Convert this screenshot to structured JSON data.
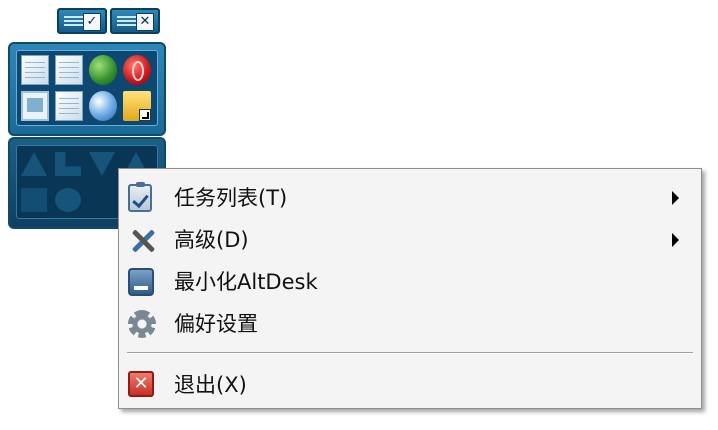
{
  "widget": {
    "top_buttons": [
      {
        "name": "confirm",
        "glyph": "✓"
      },
      {
        "name": "close",
        "glyph": "✕"
      }
    ],
    "icons": [
      "notepad-icon",
      "notepad-icon",
      "network-globe-icon",
      "opera-icon",
      "monitor-icon",
      "notepad-icon",
      "browser-globe-icon",
      "folder-shortcut-icon"
    ]
  },
  "context_menu": {
    "items": [
      {
        "label": "任务列表(T)",
        "icon": "clipboard-check-icon",
        "submenu": true
      },
      {
        "label": "高级(D)",
        "icon": "tools-icon",
        "submenu": true
      },
      {
        "label": "最小化AltDesk",
        "icon": "window-minimize-icon",
        "submenu": false
      },
      {
        "label": "偏好设置",
        "icon": "gear-icon",
        "submenu": false
      },
      {
        "label": "退出(X)",
        "icon": "exit-icon",
        "submenu": false
      }
    ]
  }
}
